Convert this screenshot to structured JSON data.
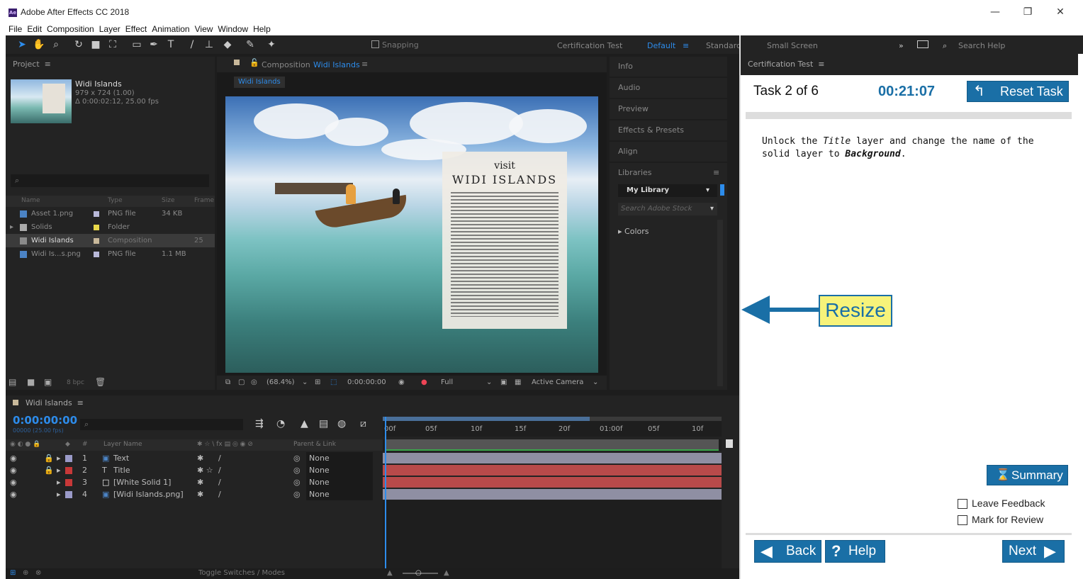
{
  "window": {
    "title": "Adobe After Effects CC 2018",
    "app_icon": "Ae",
    "minimize": "—",
    "restore": "❐",
    "close": "✕"
  },
  "menu": [
    "File",
    "Edit",
    "Composition",
    "Layer",
    "Effect",
    "Animation",
    "View",
    "Window",
    "Help"
  ],
  "toolbar": {
    "snapping": "Snapping",
    "workspaces": [
      "Certification Test",
      "Default",
      "Standard",
      "Small Screen"
    ],
    "active_workspace": "Default",
    "search_help": "Search Help"
  },
  "project": {
    "title": "Project",
    "comp_name": "Widi Islands",
    "comp_dims": "979 x 724 (1.00)",
    "comp_duration": "Δ 0:00:02:12, 25.00 fps",
    "search_placeholder": "",
    "columns": [
      "Name",
      "Type",
      "Size",
      "Frame"
    ],
    "items": [
      {
        "name": "Asset 1.png",
        "type": "PNG file",
        "size": "34 KB",
        "label": "#b8b8d8"
      },
      {
        "name": "Solids",
        "type": "Folder",
        "size": "",
        "label": "#e8d84a"
      },
      {
        "name": "Widi Islands",
        "type": "Composition",
        "size": "25",
        "label": "#c8b89a"
      },
      {
        "name": "Widi Is...s.png",
        "type": "PNG file",
        "size": "1.1 MB",
        "label": "#b8b8d8"
      }
    ],
    "bpc": "8 bpc"
  },
  "composition": {
    "tab_label": "Composition",
    "tab_name": "Widi Islands",
    "subtab": "Widi Islands",
    "card_visit": "visit",
    "card_title": "WIDI ISLANDS",
    "zoom": "(68.4%)",
    "timecode": "0:00:00:00",
    "resolution": "Full",
    "camera": "Active Camera"
  },
  "right_panels": {
    "items": [
      "Info",
      "Audio",
      "Preview",
      "Effects & Presets",
      "Align",
      "Libraries"
    ],
    "library": "My Library",
    "stock_search": "Search Adobe Stock",
    "colors": "Colors"
  },
  "timeline": {
    "comp_name": "Widi Islands",
    "timecode": "0:00:00:00",
    "timecode_sub": "00000 (25.00 fps)",
    "ruler": [
      "00f",
      "05f",
      "10f",
      "15f",
      "20f",
      "01:00f",
      "05f",
      "10f"
    ],
    "col_layer_name": "Layer Name",
    "col_parent": "Parent & Link",
    "layers": [
      {
        "num": "1",
        "name": "Text",
        "parent": "None",
        "label": "#9a9ac8",
        "type_icon": "▣",
        "locked": true
      },
      {
        "num": "2",
        "name": "Title",
        "parent": "None",
        "label": "#c83838",
        "type_icon": "T",
        "locked": true
      },
      {
        "num": "3",
        "name": "[White Solid 1]",
        "parent": "None",
        "label": "#c83838",
        "type_icon": "□",
        "locked": false
      },
      {
        "num": "4",
        "name": "[Widi Islands.png]",
        "parent": "None",
        "label": "#9a9ac8",
        "type_icon": "▣",
        "locked": false
      }
    ],
    "track_colors": [
      "#8f8fa3",
      "#b84a4a",
      "#b84a4a",
      "#8f8fa3"
    ],
    "toggle_modes": "Toggle Switches / Modes"
  },
  "cert": {
    "panel_title": "Certification Test",
    "task": "Task 2 of 6",
    "timer": "00:21:07",
    "reset_label": "Reset Task",
    "instruction_a": "Unlock the ",
    "instruction_title": "Title",
    "instruction_b": " layer and change the name of the solid layer to ",
    "instruction_bg": "Background",
    "instruction_end": ".",
    "resize_label": "Resize",
    "summary_label": "Summary",
    "leave_feedback": "Leave Feedback",
    "mark_review": "Mark for Review",
    "back_label": "Back",
    "help_label": "Help",
    "next_label": "Next",
    "accent": "#1a6fa6",
    "callout_fill": "#f7f37a"
  }
}
